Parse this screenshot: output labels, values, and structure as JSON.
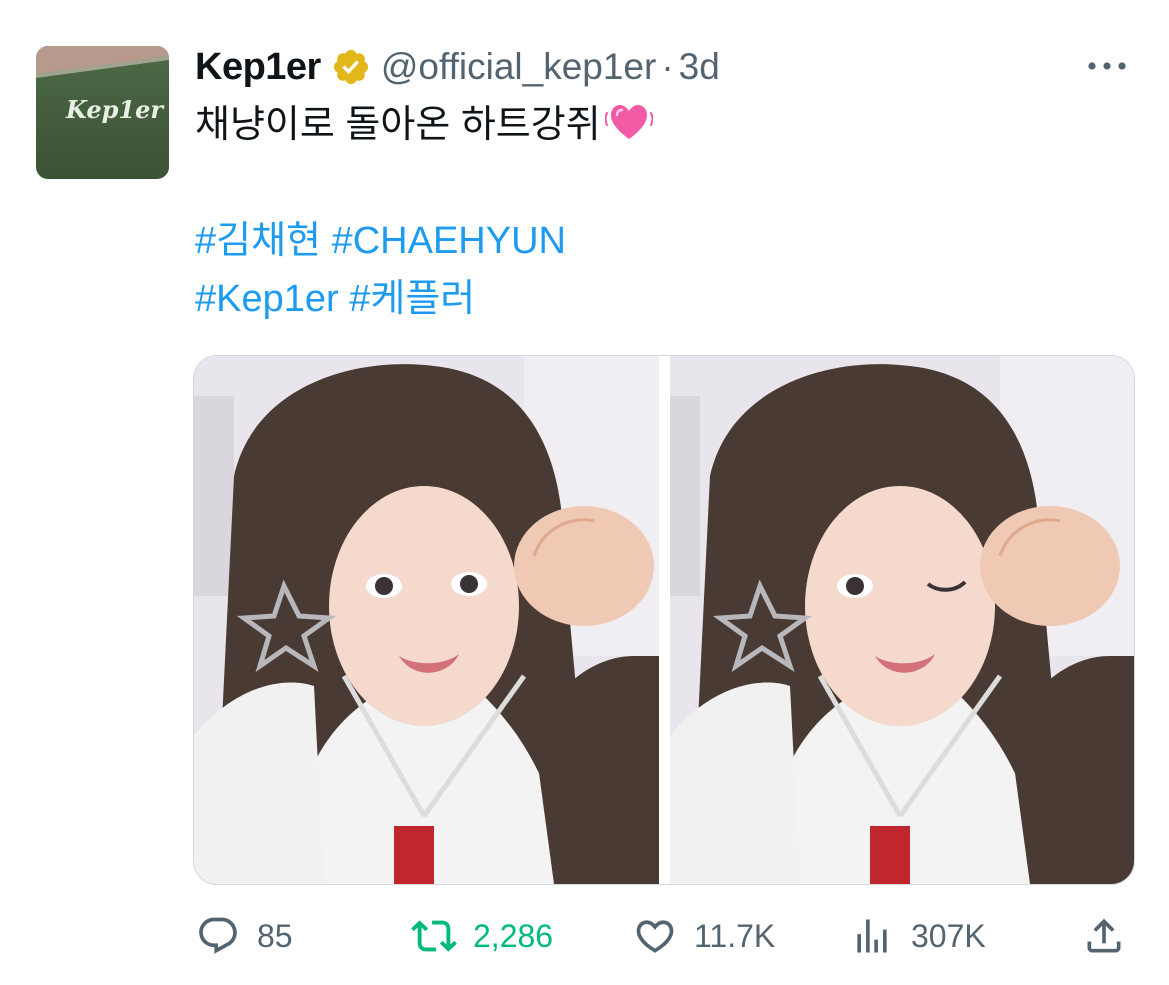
{
  "author": {
    "display_name": "Kep1er",
    "handle": "@official_kep1er",
    "separator": "·",
    "time": "3d",
    "verified": true,
    "avatar_icon": "kep1er-logo-avatar",
    "avatar_text": "Kep1er"
  },
  "tweet": {
    "line1": "채냥이로 돌아온 하트강쥐",
    "emoji": "vibrating-heart-emoji",
    "hashtags_row1": [
      "#김채현",
      "#CHAEHYUN"
    ],
    "hashtags_row2": [
      "#Kep1er",
      "#케플러"
    ]
  },
  "media": {
    "count": 2,
    "photo_icons": [
      "selfie-photo",
      "selfie-photo-wink"
    ]
  },
  "actions": {
    "reply_count": "85",
    "retweet_count": "2,286",
    "like_count": "11.7K",
    "views_count": "307K"
  },
  "colors": {
    "accent": "#1d9bf0",
    "retweet": "#00ba7c",
    "muted": "#536471",
    "verified_gold": "#e2b719"
  }
}
